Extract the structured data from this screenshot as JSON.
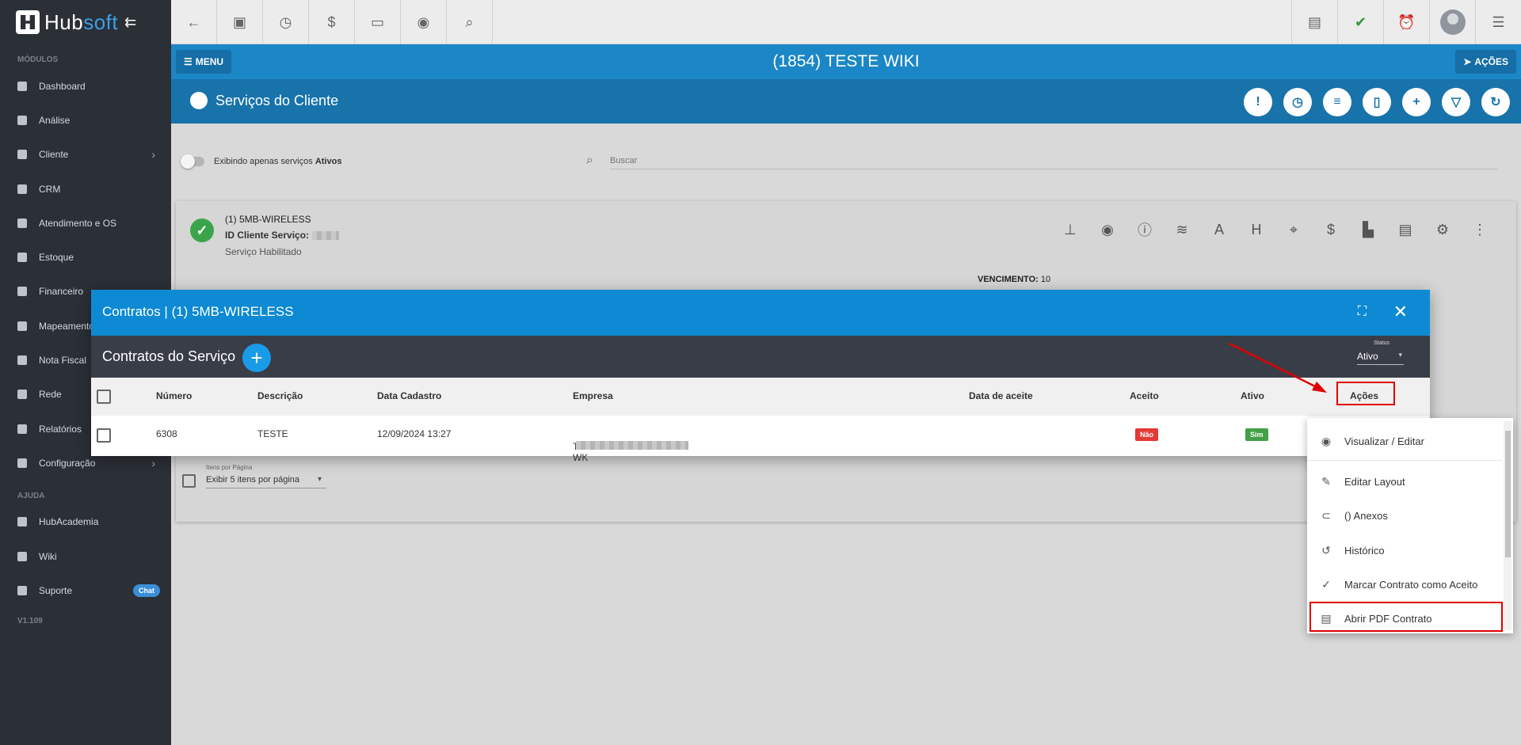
{
  "brand": {
    "name_a": "Hub",
    "name_b": "soft"
  },
  "sidebar": {
    "section_modules": "MÓDULOS",
    "items": [
      {
        "label": "Dashboard"
      },
      {
        "label": "Análise"
      },
      {
        "label": "Cliente",
        "arrow": "›"
      },
      {
        "label": "CRM"
      },
      {
        "label": "Atendimento e OS"
      },
      {
        "label": "Estoque"
      },
      {
        "label": "Financeiro"
      },
      {
        "label": "Mapeamento"
      },
      {
        "label": "Nota Fiscal"
      },
      {
        "label": "Rede"
      },
      {
        "label": "Relatórios"
      },
      {
        "label": "Configuração",
        "arrow": "›"
      }
    ],
    "section_help": "AJUDA",
    "help_items": [
      {
        "label": "HubAcademia"
      },
      {
        "label": "Wiki"
      },
      {
        "label": "Suporte",
        "badge": "Chat"
      }
    ],
    "version": "V1.109"
  },
  "titlebar": {
    "menu": "MENU",
    "title": "(1854) TESTE WIKI",
    "actions": "AÇÕES"
  },
  "subbar": {
    "title": "Serviços do Cliente"
  },
  "filters": {
    "toggle_text": "Exibindo apenas serviços",
    "toggle_bold": "Ativos",
    "search_placeholder": "Buscar"
  },
  "service": {
    "name": "(1) 5MB-WIRELESS",
    "id_label": "ID Cliente Serviço:",
    "status": "Serviço Habilitado",
    "vencimento_label": "VENCIMENTO:",
    "vencimento_value": "10"
  },
  "pager": {
    "label": "Itens por Página",
    "value": "Exibir 5 itens por página"
  },
  "modal": {
    "title": "Contratos | (1) 5MB-WIRELESS",
    "subtitle": "Contratos do Serviço",
    "status_label": "Status",
    "status_value": "Ativo",
    "columns": {
      "numero": "Número",
      "descricao": "Descrição",
      "data_cadastro": "Data Cadastro",
      "empresa": "Empresa",
      "data_aceite": "Data de aceite",
      "aceito": "Aceito",
      "ativo": "Ativo",
      "acoes": "Ações"
    },
    "rows": [
      {
        "numero": "6308",
        "descricao": "TESTE",
        "data_cadastro": "12/09/2024 13:27",
        "empresa": "TESTE WK",
        "aceito": "Não",
        "ativo": "Sim"
      }
    ]
  },
  "dropdown": {
    "items": [
      {
        "label": "Visualizar / Editar",
        "icon": "eye-icon"
      },
      {
        "label": "Editar Layout",
        "icon": "edit-icon"
      },
      {
        "label": "() Anexos",
        "icon": "paperclip-icon"
      },
      {
        "label": "Histórico",
        "icon": "history-icon"
      },
      {
        "label": "Marcar Contrato como Aceito",
        "icon": "bookmark-check-icon"
      },
      {
        "label": "Abrir PDF Contrato",
        "icon": "pdf-icon"
      }
    ]
  },
  "colors": {
    "accent": "#0d8ad3",
    "sidebar": "#2b2f36",
    "highlight": "#e00000",
    "badge_no": "#e53935",
    "badge_yes": "#43a047"
  }
}
